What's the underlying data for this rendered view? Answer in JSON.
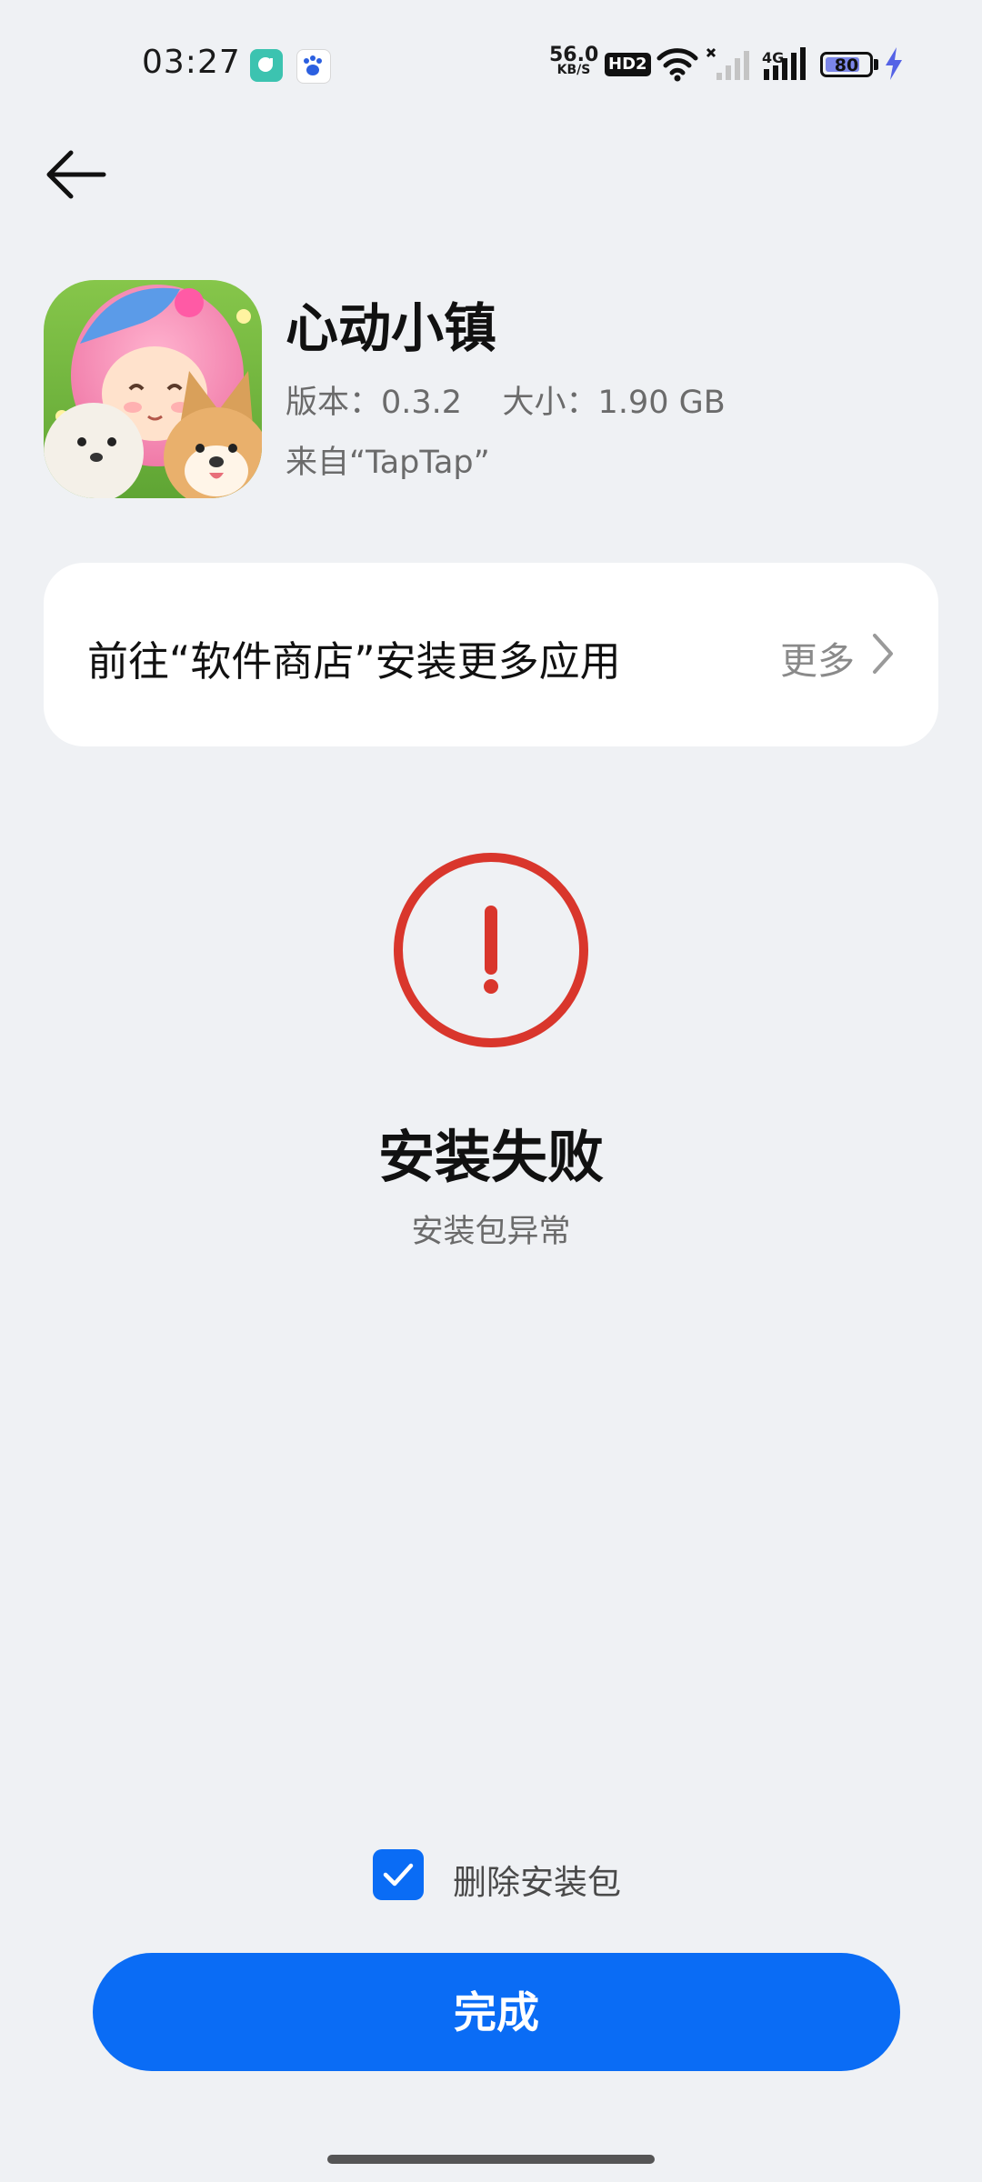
{
  "status_bar": {
    "time": "03:27",
    "net_speed_value": "56.0",
    "net_speed_unit": "KB/S",
    "hd_badge": "HD2",
    "network_type": "4G",
    "battery_level": "80",
    "battery_fraction": 0.8,
    "icons": [
      "chat-app-icon",
      "baidu-app-icon",
      "wifi-icon",
      "no-signal-sim1-icon",
      "signal-sim2-icon",
      "battery-icon",
      "charging-bolt-icon"
    ]
  },
  "header": {
    "back_icon": "back-arrow-icon"
  },
  "app": {
    "name": "心动小镇",
    "version_size": "版本：0.3.2    大小：1.90 GB",
    "source": "来自“TapTap”"
  },
  "store_card": {
    "text": "前往“软件商店”安装更多应用",
    "more_label": "更多",
    "chevron_icon": "chevron-right-icon"
  },
  "result": {
    "icon": "error-exclamation-icon",
    "accent_color": "#d9362c",
    "title": "安装失败",
    "description": "安装包异常"
  },
  "options": {
    "delete_package_label": "删除安装包",
    "delete_package_checked": true
  },
  "actions": {
    "done_label": "完成",
    "primary_color": "#0a6cf5"
  }
}
